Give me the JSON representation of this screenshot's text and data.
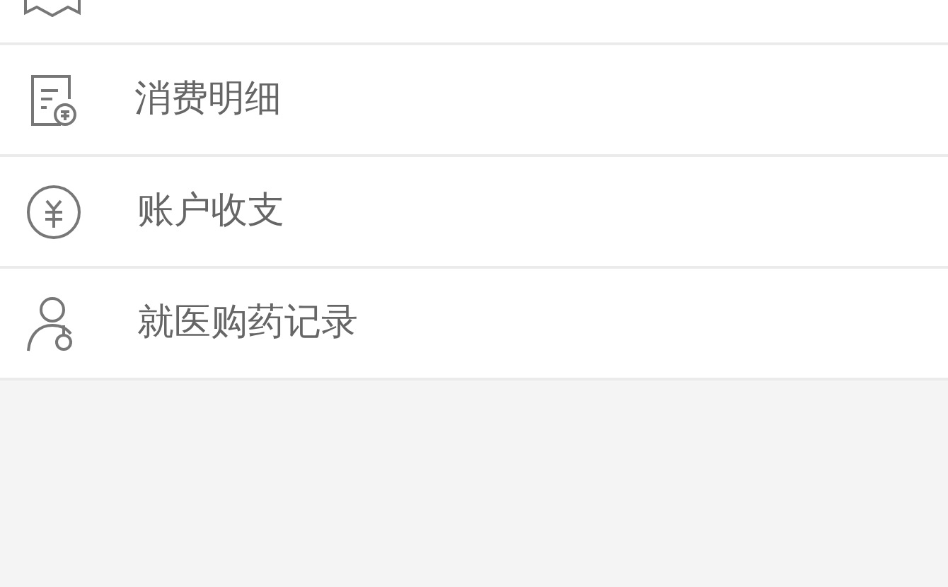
{
  "menu": {
    "items": [
      {
        "kind": "cut"
      },
      {
        "kind": "receipt",
        "label": "消费明细"
      },
      {
        "kind": "coin",
        "label": "账户收支"
      },
      {
        "kind": "person",
        "label": "就医购药记录"
      }
    ]
  }
}
